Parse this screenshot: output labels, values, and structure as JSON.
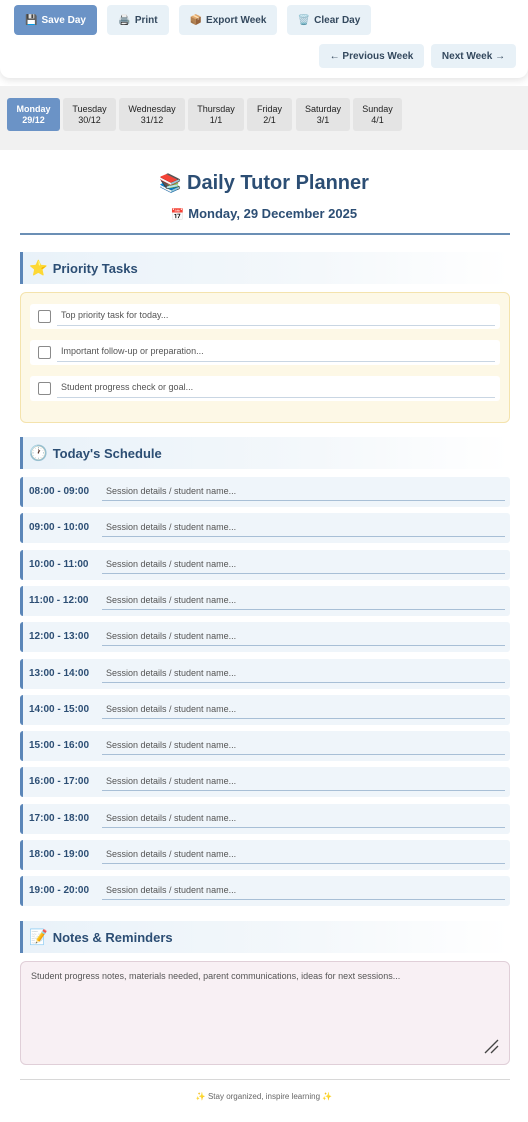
{
  "toolbar": {
    "save_label": "Save Day",
    "print_label": "Print",
    "export_label": "Export Week",
    "clear_label": "Clear Day",
    "prev_label": "← Previous Week",
    "next_label": "Next Week →"
  },
  "days": [
    {
      "name": "Monday",
      "date": "29/12",
      "active": true
    },
    {
      "name": "Tuesday",
      "date": "30/12",
      "active": false
    },
    {
      "name": "Wednesday",
      "date": "31/12",
      "active": false
    },
    {
      "name": "Thursday",
      "date": "1/1",
      "active": false
    },
    {
      "name": "Friday",
      "date": "2/1",
      "active": false
    },
    {
      "name": "Saturday",
      "date": "3/1",
      "active": false
    },
    {
      "name": "Sunday",
      "date": "4/1",
      "active": false
    }
  ],
  "header": {
    "title": "Daily Tutor Planner",
    "date": "Monday, 29 December 2025"
  },
  "priority": {
    "heading": "Priority Tasks",
    "tasks": [
      {
        "placeholder": "Top priority task for today...",
        "checked": false
      },
      {
        "placeholder": "Important follow-up or preparation...",
        "checked": false
      },
      {
        "placeholder": "Student progress check or goal...",
        "checked": false
      }
    ]
  },
  "schedule": {
    "heading": "Today's Schedule",
    "slots": [
      {
        "time": "08:00 - 09:00",
        "placeholder": "Session details / student name..."
      },
      {
        "time": "09:00 - 10:00",
        "placeholder": "Session details / student name..."
      },
      {
        "time": "10:00 - 11:00",
        "placeholder": "Session details / student name..."
      },
      {
        "time": "11:00 - 12:00",
        "placeholder": "Session details / student name..."
      },
      {
        "time": "12:00 - 13:00",
        "placeholder": "Session details / student name..."
      },
      {
        "time": "13:00 - 14:00",
        "placeholder": "Session details / student name..."
      },
      {
        "time": "14:00 - 15:00",
        "placeholder": "Session details / student name..."
      },
      {
        "time": "15:00 - 16:00",
        "placeholder": "Session details / student name..."
      },
      {
        "time": "16:00 - 17:00",
        "placeholder": "Session details / student name..."
      },
      {
        "time": "17:00 - 18:00",
        "placeholder": "Session details / student name..."
      },
      {
        "time": "18:00 - 19:00",
        "placeholder": "Session details / student name..."
      },
      {
        "time": "19:00 - 20:00",
        "placeholder": "Session details / student name..."
      }
    ]
  },
  "notes": {
    "heading": "Notes & Reminders",
    "placeholder": "Student progress notes, materials needed, parent communications, ideas for next sessions..."
  },
  "footer": {
    "text": "✨ Stay organized, inspire learning ✨"
  },
  "icons": {
    "save": "floppy-disk-icon",
    "print": "printer-icon",
    "export": "package-icon",
    "clear": "trash-icon",
    "title": "books-icon",
    "date": "calendar-icon",
    "priority": "star-icon",
    "schedule": "clock-icon",
    "notes": "memo-icon"
  },
  "colors": {
    "accent": "#6b93c6",
    "heading": "#2c4e74",
    "priority_bg": "#fdf8e6",
    "slot_bg": "#eff5fa",
    "notes_bg": "#f8f0f4"
  }
}
